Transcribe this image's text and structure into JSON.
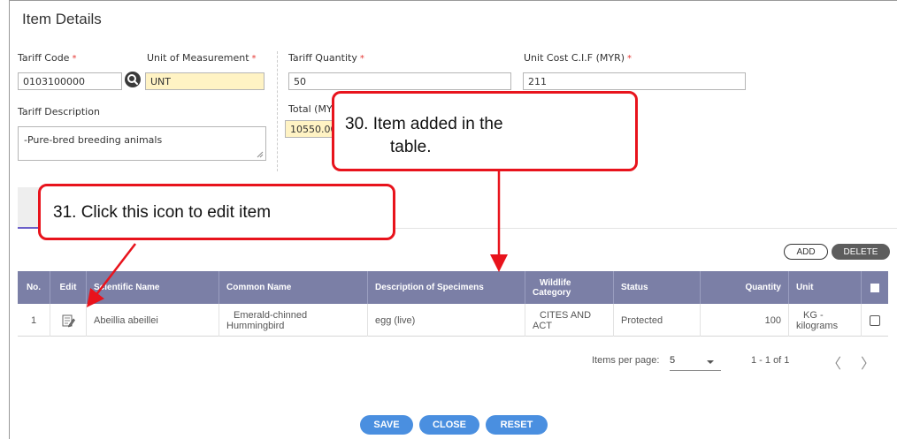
{
  "form": {
    "title": "Item Details",
    "tariff_code_label": "Tariff Code",
    "tariff_code_value": "0103100000",
    "uom_label": "Unit of Measurement",
    "uom_value": "UNT",
    "tariff_qty_label": "Tariff Quantity",
    "tariff_qty_value": "50",
    "unit_cost_label": "Unit Cost C.I.F (MYR)",
    "unit_cost_value": "211",
    "tariff_desc_label": "Tariff Description",
    "tariff_desc_value": "-Pure-bred breeding animals",
    "total_label": "Total (MY",
    "total_value": "10550.00",
    "required_mark": "*"
  },
  "toolbar": {
    "add_label": "ADD",
    "delete_label": "DELETE"
  },
  "table": {
    "headers": {
      "no": "No.",
      "edit": "Edit",
      "scientific_name": "Scientific Name",
      "common_name": "Common Name",
      "description": "Description of Specimens",
      "wildlife_category_1": "Wildlife",
      "wildlife_category_2": "Category",
      "status": "Status",
      "quantity": "Quantity",
      "unit": "Unit"
    },
    "rows": [
      {
        "no": "1",
        "scientific_name": "Abeillia abeillei",
        "common_name_1": "Emerald-chinned",
        "common_name_2": "Hummingbird",
        "description": "egg (live)",
        "wildlife_category_1": "CITES AND",
        "wildlife_category_2": "ACT",
        "status": "Protected",
        "quantity": "100",
        "unit_1": "KG -",
        "unit_2": "kilograms"
      }
    ]
  },
  "pager": {
    "items_per_page_label": "Items per page:",
    "items_per_page_value": "5",
    "range_text": "1 - 1 of 1",
    "prev_symbol": "〈",
    "next_symbol": "〉"
  },
  "actions": {
    "save_label": "SAVE",
    "close_label": "CLOSE",
    "reset_label": "RESET"
  },
  "callouts": {
    "item_added_line1": "30.  Item added in the",
    "item_added_line2": "table.",
    "edit_hint": "31.  Click this icon to edit item"
  },
  "colors": {
    "accent_red": "#e8131c",
    "header_bg": "#7b7fa6",
    "button_blue": "#4a8fe0",
    "readonly_yellow": "#fff3c4"
  },
  "icons": {
    "search": "magnifier-icon",
    "edit": "edit-document-icon"
  }
}
